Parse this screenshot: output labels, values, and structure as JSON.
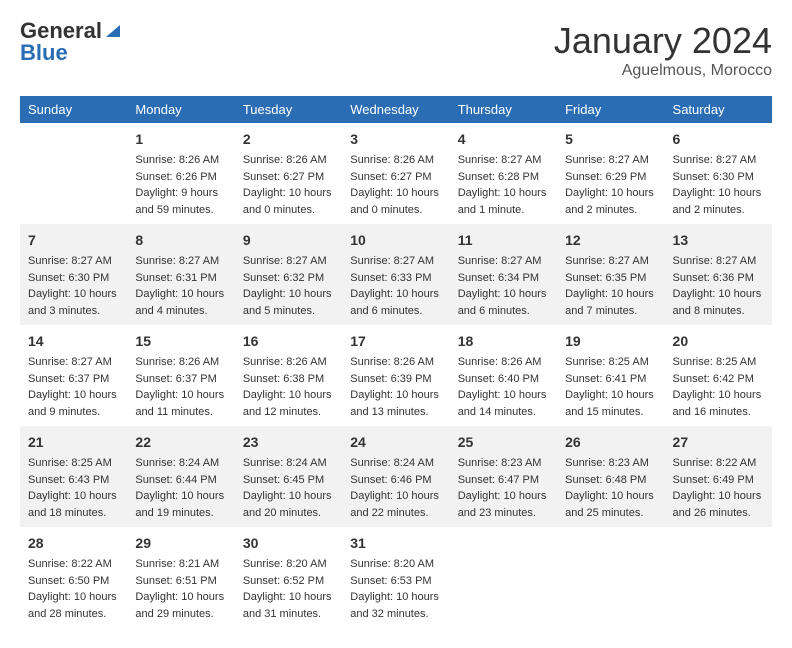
{
  "logo": {
    "general": "General",
    "blue": "Blue"
  },
  "title": "January 2024",
  "subtitle": "Aguelmous, Morocco",
  "days_of_week": [
    "Sunday",
    "Monday",
    "Tuesday",
    "Wednesday",
    "Thursday",
    "Friday",
    "Saturday"
  ],
  "weeks": [
    [
      {
        "num": "",
        "info": ""
      },
      {
        "num": "1",
        "info": "Sunrise: 8:26 AM\nSunset: 6:26 PM\nDaylight: 9 hours\nand 59 minutes."
      },
      {
        "num": "2",
        "info": "Sunrise: 8:26 AM\nSunset: 6:27 PM\nDaylight: 10 hours\nand 0 minutes."
      },
      {
        "num": "3",
        "info": "Sunrise: 8:26 AM\nSunset: 6:27 PM\nDaylight: 10 hours\nand 0 minutes."
      },
      {
        "num": "4",
        "info": "Sunrise: 8:27 AM\nSunset: 6:28 PM\nDaylight: 10 hours\nand 1 minute."
      },
      {
        "num": "5",
        "info": "Sunrise: 8:27 AM\nSunset: 6:29 PM\nDaylight: 10 hours\nand 2 minutes."
      },
      {
        "num": "6",
        "info": "Sunrise: 8:27 AM\nSunset: 6:30 PM\nDaylight: 10 hours\nand 2 minutes."
      }
    ],
    [
      {
        "num": "7",
        "info": "Sunrise: 8:27 AM\nSunset: 6:30 PM\nDaylight: 10 hours\nand 3 minutes."
      },
      {
        "num": "8",
        "info": "Sunrise: 8:27 AM\nSunset: 6:31 PM\nDaylight: 10 hours\nand 4 minutes."
      },
      {
        "num": "9",
        "info": "Sunrise: 8:27 AM\nSunset: 6:32 PM\nDaylight: 10 hours\nand 5 minutes."
      },
      {
        "num": "10",
        "info": "Sunrise: 8:27 AM\nSunset: 6:33 PM\nDaylight: 10 hours\nand 6 minutes."
      },
      {
        "num": "11",
        "info": "Sunrise: 8:27 AM\nSunset: 6:34 PM\nDaylight: 10 hours\nand 6 minutes."
      },
      {
        "num": "12",
        "info": "Sunrise: 8:27 AM\nSunset: 6:35 PM\nDaylight: 10 hours\nand 7 minutes."
      },
      {
        "num": "13",
        "info": "Sunrise: 8:27 AM\nSunset: 6:36 PM\nDaylight: 10 hours\nand 8 minutes."
      }
    ],
    [
      {
        "num": "14",
        "info": "Sunrise: 8:27 AM\nSunset: 6:37 PM\nDaylight: 10 hours\nand 9 minutes."
      },
      {
        "num": "15",
        "info": "Sunrise: 8:26 AM\nSunset: 6:37 PM\nDaylight: 10 hours\nand 11 minutes."
      },
      {
        "num": "16",
        "info": "Sunrise: 8:26 AM\nSunset: 6:38 PM\nDaylight: 10 hours\nand 12 minutes."
      },
      {
        "num": "17",
        "info": "Sunrise: 8:26 AM\nSunset: 6:39 PM\nDaylight: 10 hours\nand 13 minutes."
      },
      {
        "num": "18",
        "info": "Sunrise: 8:26 AM\nSunset: 6:40 PM\nDaylight: 10 hours\nand 14 minutes."
      },
      {
        "num": "19",
        "info": "Sunrise: 8:25 AM\nSunset: 6:41 PM\nDaylight: 10 hours\nand 15 minutes."
      },
      {
        "num": "20",
        "info": "Sunrise: 8:25 AM\nSunset: 6:42 PM\nDaylight: 10 hours\nand 16 minutes."
      }
    ],
    [
      {
        "num": "21",
        "info": "Sunrise: 8:25 AM\nSunset: 6:43 PM\nDaylight: 10 hours\nand 18 minutes."
      },
      {
        "num": "22",
        "info": "Sunrise: 8:24 AM\nSunset: 6:44 PM\nDaylight: 10 hours\nand 19 minutes."
      },
      {
        "num": "23",
        "info": "Sunrise: 8:24 AM\nSunset: 6:45 PM\nDaylight: 10 hours\nand 20 minutes."
      },
      {
        "num": "24",
        "info": "Sunrise: 8:24 AM\nSunset: 6:46 PM\nDaylight: 10 hours\nand 22 minutes."
      },
      {
        "num": "25",
        "info": "Sunrise: 8:23 AM\nSunset: 6:47 PM\nDaylight: 10 hours\nand 23 minutes."
      },
      {
        "num": "26",
        "info": "Sunrise: 8:23 AM\nSunset: 6:48 PM\nDaylight: 10 hours\nand 25 minutes."
      },
      {
        "num": "27",
        "info": "Sunrise: 8:22 AM\nSunset: 6:49 PM\nDaylight: 10 hours\nand 26 minutes."
      }
    ],
    [
      {
        "num": "28",
        "info": "Sunrise: 8:22 AM\nSunset: 6:50 PM\nDaylight: 10 hours\nand 28 minutes."
      },
      {
        "num": "29",
        "info": "Sunrise: 8:21 AM\nSunset: 6:51 PM\nDaylight: 10 hours\nand 29 minutes."
      },
      {
        "num": "30",
        "info": "Sunrise: 8:20 AM\nSunset: 6:52 PM\nDaylight: 10 hours\nand 31 minutes."
      },
      {
        "num": "31",
        "info": "Sunrise: 8:20 AM\nSunset: 6:53 PM\nDaylight: 10 hours\nand 32 minutes."
      },
      {
        "num": "",
        "info": ""
      },
      {
        "num": "",
        "info": ""
      },
      {
        "num": "",
        "info": ""
      }
    ]
  ]
}
